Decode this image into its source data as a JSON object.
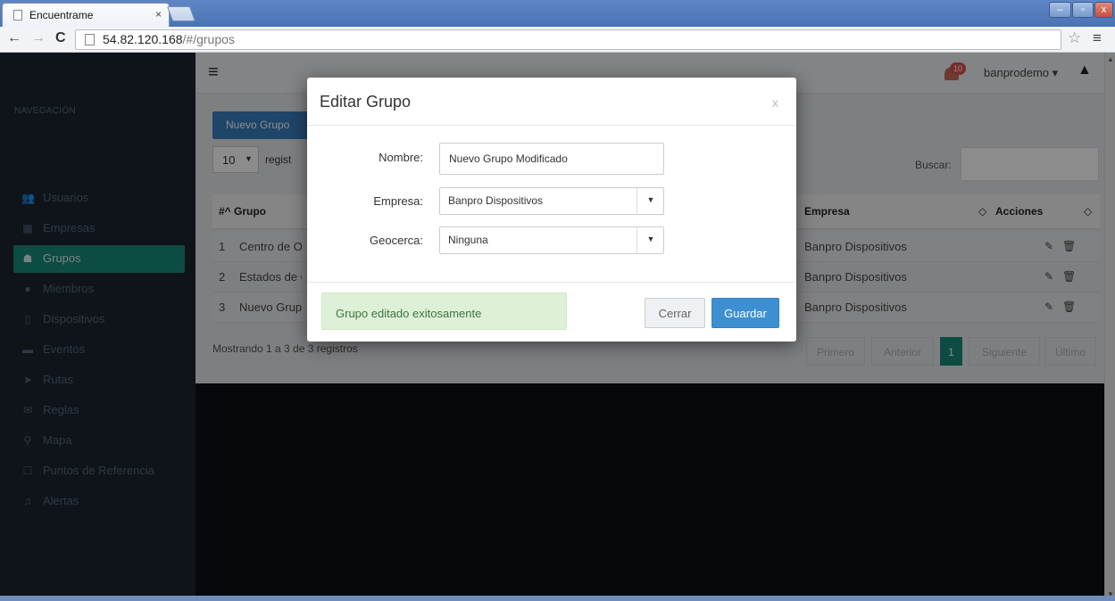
{
  "browser": {
    "tab_title": "Encuentrame",
    "tab_close": "×",
    "address_host": "54.82.120.168",
    "address_path": "/#/grupos",
    "back": "←",
    "forward": "→",
    "reload": "C",
    "star": "☆",
    "menu": "≡",
    "win_min": "–",
    "win_max": "▫",
    "win_close": "x"
  },
  "sidebar": {
    "heading": "NAVEGACIÓN",
    "items": [
      {
        "label": "Usuarios",
        "icon": "users-icon",
        "glyph": "👥"
      },
      {
        "label": "Empresas",
        "icon": "building-icon",
        "glyph": "▦"
      },
      {
        "label": "Grupos",
        "icon": "sitemap-icon",
        "glyph": "☗"
      },
      {
        "label": "Miembros",
        "icon": "user-icon",
        "glyph": "●"
      },
      {
        "label": "Dispositivos",
        "icon": "mobile-icon",
        "glyph": "▯"
      },
      {
        "label": "Eventos",
        "icon": "inbox-icon",
        "glyph": "▬"
      },
      {
        "label": "Rutas",
        "icon": "location-arrow-icon",
        "glyph": "➤"
      },
      {
        "label": "Reglas",
        "icon": "envelope-icon",
        "glyph": "✉"
      },
      {
        "label": "Mapa",
        "icon": "map-marker-icon",
        "glyph": "⚲"
      },
      {
        "label": "Puntos de Referencia",
        "icon": "square-icon",
        "glyph": "☐"
      },
      {
        "label": "Alertas",
        "icon": "bell-icon",
        "glyph": "♫"
      }
    ],
    "active_index": 2
  },
  "topbar": {
    "hamburger": "≡",
    "notification_count": "10",
    "username": "banprodemo ▾",
    "user_icon": "▲"
  },
  "content": {
    "new_button": "Nuevo Grupo",
    "page_length": "10",
    "page_length_suffix": "regist",
    "search_label": "Buscar:",
    "columns": {
      "id": "#^ Grupo",
      "empresa": "Empresa",
      "sort1": "◇",
      "acciones": "Acciones",
      "sort2": "◇"
    },
    "rows": [
      {
        "id": "1",
        "grupo": "Centro de Op",
        "empresa": "Banpro Dispositivos"
      },
      {
        "id": "2",
        "grupo": "Estados de C",
        "empresa": "Banpro Dispositivos"
      },
      {
        "id": "3",
        "grupo": "Nuevo Grupo",
        "empresa": "Banpro Dispositivos"
      }
    ],
    "edit_glyph": "✎",
    "delete_glyph": "🗑",
    "info": "Mostrando 1 a 3 de 3 registros",
    "pagination": [
      "Primero",
      "Anterior",
      "1",
      "Siguiente",
      "Último"
    ]
  },
  "modal": {
    "title": "Editar Grupo",
    "close_x": "x",
    "nombre_label": "Nombre:",
    "nombre_value": "Nuevo Grupo Modificado",
    "empresa_label": "Empresa:",
    "empresa_value": "Banpro Dispositivos",
    "geocerca_label": "Geocerca:",
    "geocerca_value": "Ninguna",
    "arrow": "▼",
    "success_message": "Grupo editado exitosamente",
    "cerrar": "Cerrar",
    "guardar": "Guardar"
  }
}
